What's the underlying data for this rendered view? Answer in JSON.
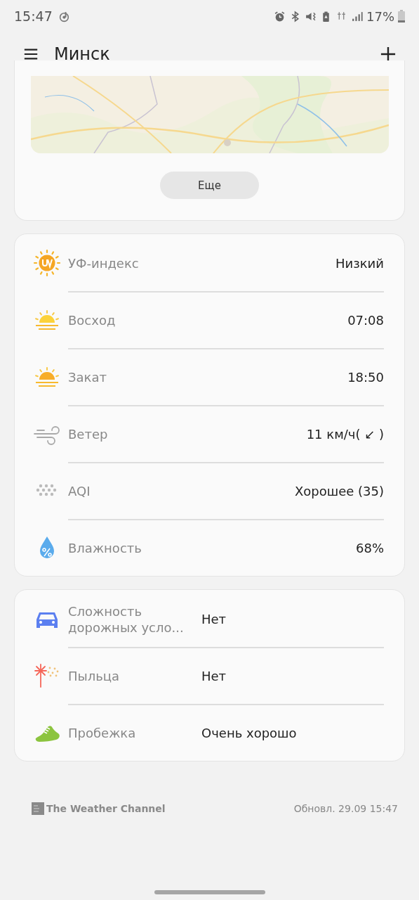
{
  "status_bar": {
    "time": "15:47",
    "battery": "17%"
  },
  "header": {
    "title": "Минск"
  },
  "map_card": {
    "more_button": "Еще"
  },
  "details": [
    {
      "kind": "uv",
      "label": "УФ-индекс",
      "value": "Низкий"
    },
    {
      "kind": "sunrise",
      "label": "Восход",
      "value": "07:08"
    },
    {
      "kind": "sunset",
      "label": "Закат",
      "value": "18:50"
    },
    {
      "kind": "wind",
      "label": "Ветер",
      "value": "11 км/ч( ↙ )"
    },
    {
      "kind": "aqi",
      "label": "AQI",
      "value": "Хорошее (35)"
    },
    {
      "kind": "humidity",
      "label": "Влажность",
      "value": "68%"
    }
  ],
  "indices": [
    {
      "kind": "traffic",
      "label": "Сложность дорожных усло...",
      "value": "Нет"
    },
    {
      "kind": "pollen",
      "label": "Пыльца",
      "value": "Нет"
    },
    {
      "kind": "running",
      "label": "Пробежка",
      "value": "Очень хорошо"
    }
  ],
  "footer": {
    "provider": "The Weather Channel",
    "updated": "Обновл. 29.09 15:47"
  }
}
